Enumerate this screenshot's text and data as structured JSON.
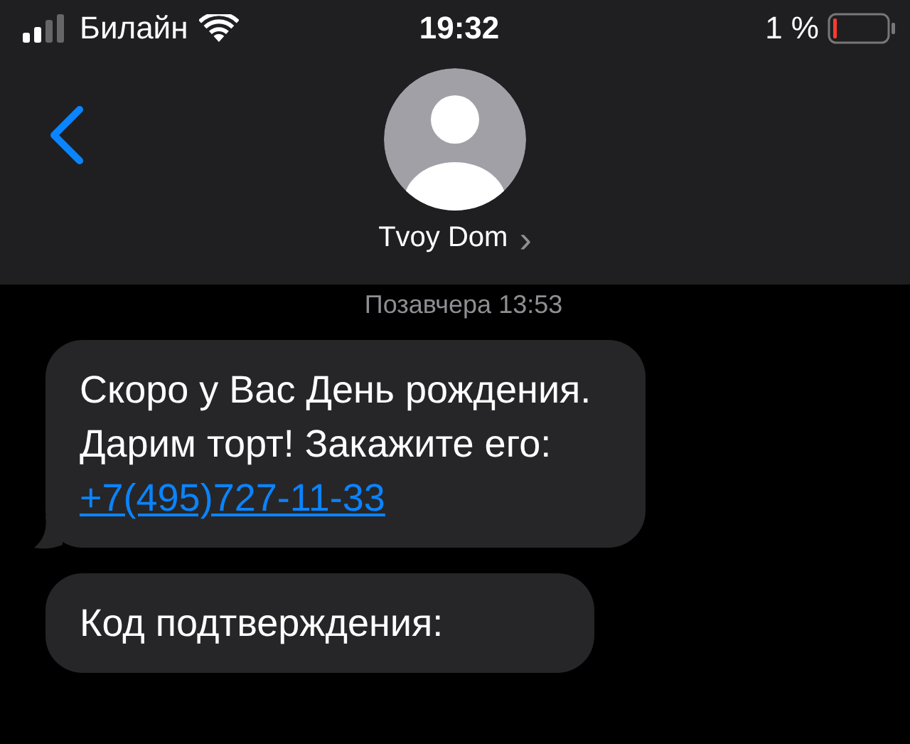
{
  "status_bar": {
    "carrier": "Билайн",
    "time": "19:32",
    "battery": "1 %"
  },
  "contact": {
    "name": "Tvoy Dom",
    "chevron": "›"
  },
  "timestamp": "Позавчера 13:53",
  "messages": [
    {
      "text": "Скоро у Вас День рождения. Дарим торт! Закажите его:",
      "link": "+7(495)727-11-33",
      "tail": true
    },
    {
      "text": "Код подтверждения:",
      "tail": false
    }
  ]
}
